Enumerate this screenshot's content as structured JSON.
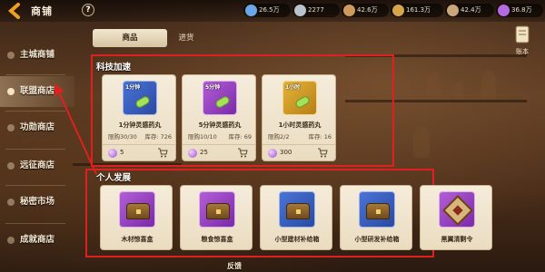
{
  "header": {
    "title": "商铺",
    "help": "?"
  },
  "currencies": [
    {
      "value": "26.5万",
      "icon": "blue-crystal-icon",
      "color": "#6aa6e8"
    },
    {
      "value": "2277",
      "icon": "silver-coin-icon",
      "color": "#b9c3cc"
    },
    {
      "value": "42.6万",
      "icon": "bronze-coin-icon",
      "color": "#d09a5a"
    },
    {
      "value": "161.3万",
      "icon": "gold-ingot-icon",
      "color": "#d6a64a"
    },
    {
      "value": "42.4万",
      "icon": "grain-sack-icon",
      "color": "#c9a77a"
    },
    {
      "value": "36.8万",
      "icon": "purple-gem-icon",
      "color": "#b56be0"
    }
  ],
  "sidebar": {
    "items": [
      {
        "label": "主城商铺",
        "active": false
      },
      {
        "label": "联盟商店",
        "active": true
      },
      {
        "label": "功勋商店",
        "active": false
      },
      {
        "label": "远征商店",
        "active": false
      },
      {
        "label": "秘密市场",
        "active": false
      },
      {
        "label": "成就商店",
        "active": false
      }
    ]
  },
  "tabs": [
    {
      "label": "商品",
      "active": true
    },
    {
      "label": "进货",
      "active": false
    }
  ],
  "ledger": {
    "label": "账本"
  },
  "sections": {
    "tech": {
      "title": "科技加速",
      "items": [
        {
          "tile_label": "1分钟",
          "name": "1分钟灵感药丸",
          "limit": "限购30/30",
          "stock": "库存: 726",
          "price": "5",
          "tile": "blue"
        },
        {
          "tile_label": "5分钟",
          "name": "5分钟灵感药丸",
          "limit": "限购10/10",
          "stock": "库存: 69",
          "price": "25",
          "tile": "purple"
        },
        {
          "tile_label": "1小时",
          "name": "1小时灵感药丸",
          "limit": "限购2/2",
          "stock": "库存: 16",
          "price": "300",
          "tile": "gold"
        }
      ]
    },
    "personal": {
      "title": "个人发展",
      "items": [
        {
          "name": "木材惊喜盒",
          "tile": "purple",
          "kind": "chest"
        },
        {
          "name": "粮食惊喜盒",
          "tile": "purple",
          "kind": "chest"
        },
        {
          "name": "小型建材补给箱",
          "tile": "blue",
          "kind": "chest"
        },
        {
          "name": "小型研发补给箱",
          "tile": "blue",
          "kind": "chest"
        },
        {
          "name": "黑翼清剿令",
          "tile": "purple",
          "kind": "edict"
        }
      ]
    }
  },
  "bottom": {
    "label": "反馈"
  }
}
